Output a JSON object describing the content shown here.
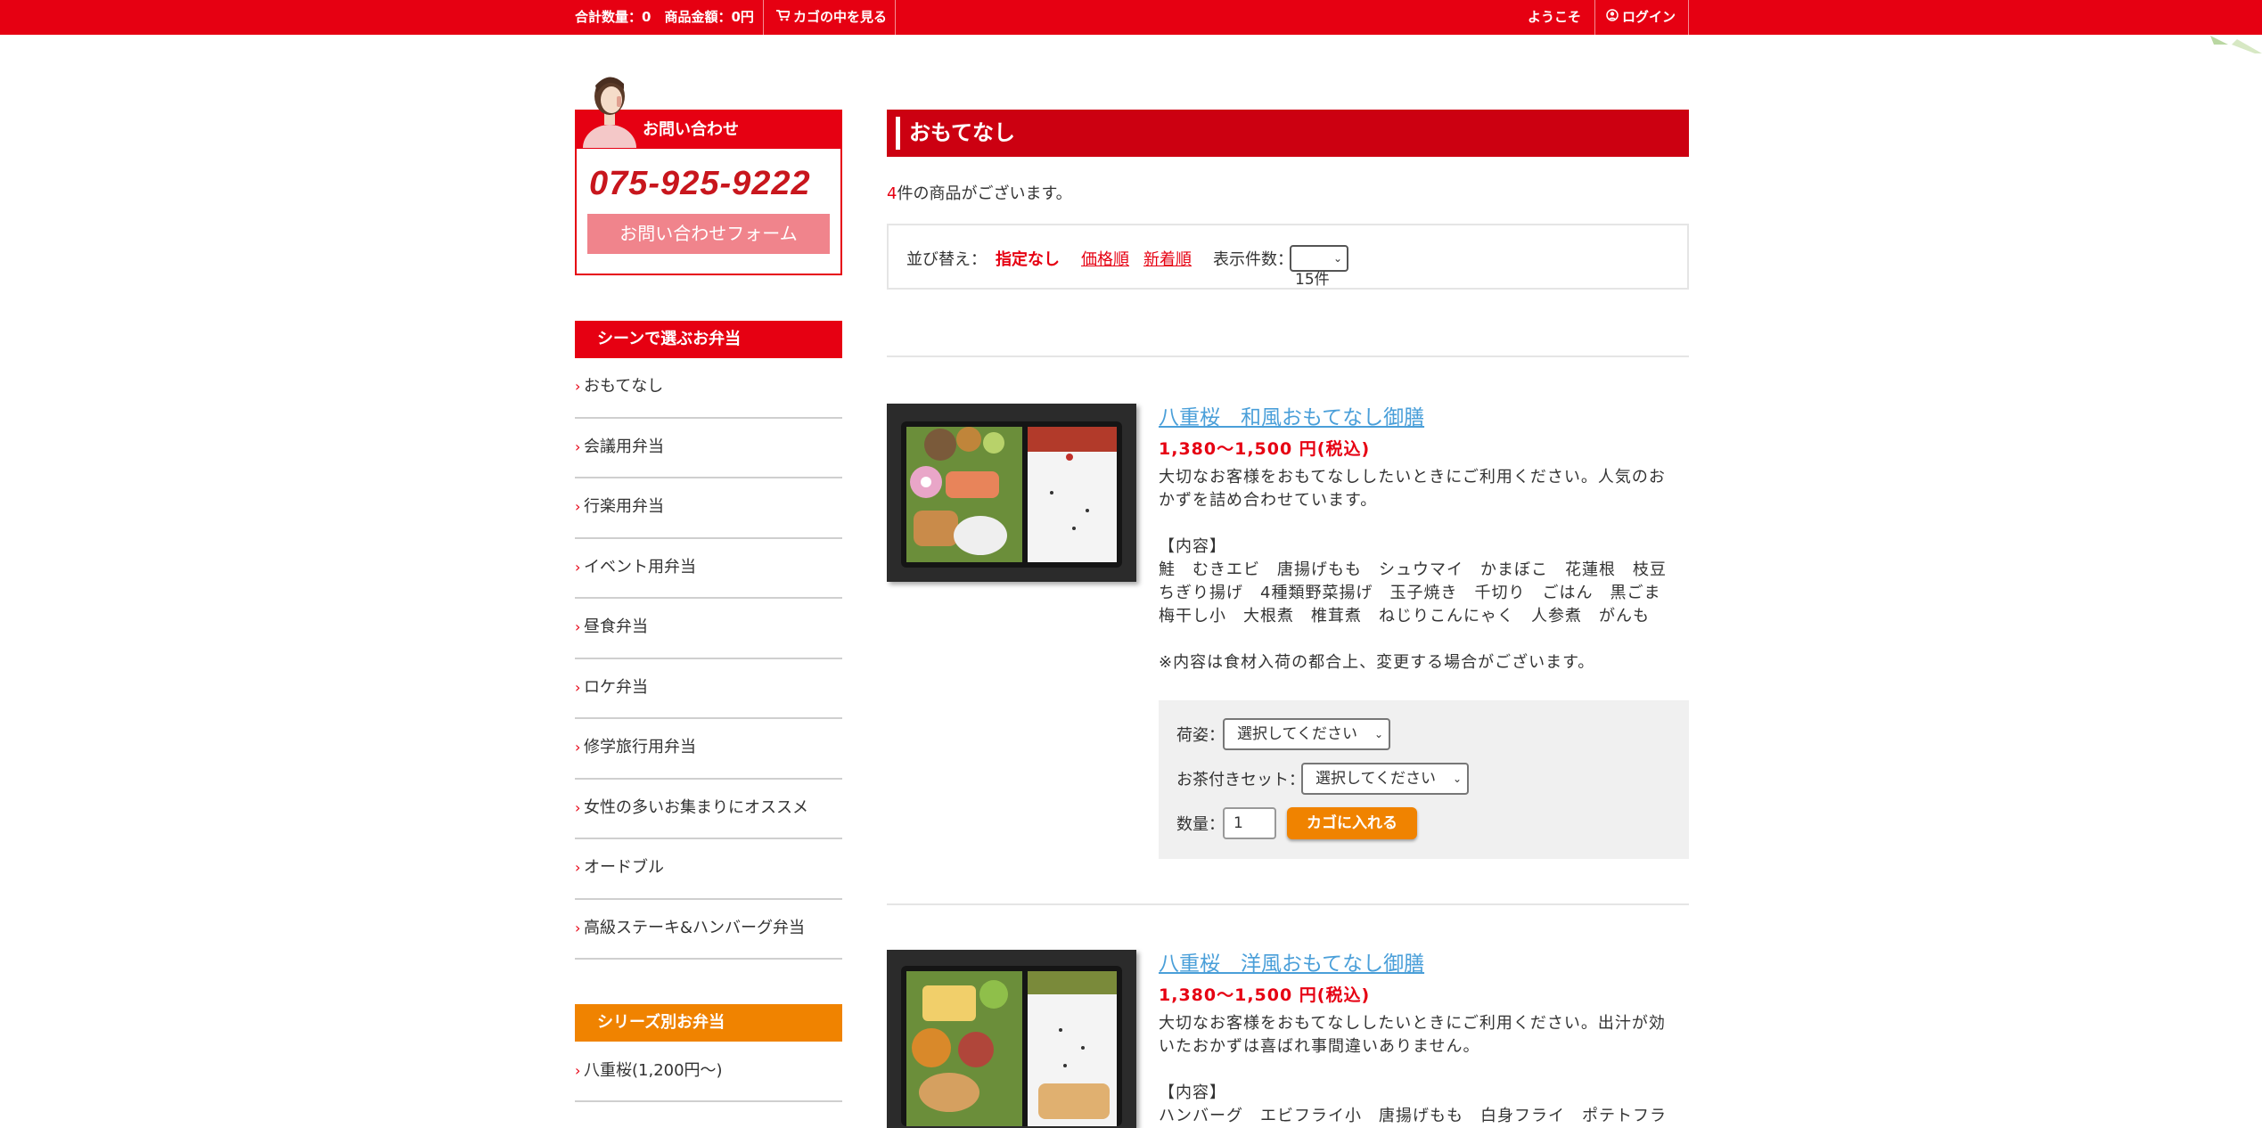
{
  "topbar": {
    "summary": "合計数量：0　商品金額：0円",
    "cart_link": "カゴの中を見る",
    "welcome": "ようこそ",
    "login": "ログイン"
  },
  "contact": {
    "title": "お問い合わせ",
    "phone": "075-925-9222",
    "form_button": "お問い合わせフォーム"
  },
  "sidebar": {
    "scene_heading": "シーンで選ぶお弁当",
    "scene_items": [
      "おもてなし",
      "会議用弁当",
      "行楽用弁当",
      "イベント用弁当",
      "昼食弁当",
      "ロケ弁当",
      "修学旅行用弁当",
      "女性の多いお集まりにオススメ",
      "オードブル",
      "高級ステーキ&ハンバーグ弁当"
    ],
    "series_heading": "シリーズ別お弁当",
    "series_items": [
      "八重桜(1,200円〜)"
    ]
  },
  "main": {
    "title": "おもてなし",
    "count_num": "4",
    "count_text": "件の商品がございます。",
    "sort": {
      "label": "並び替え：",
      "current": "指定なし",
      "price": "価格順",
      "newest": "新着順",
      "per_page_label": "表示件数：",
      "per_page_value": "15件"
    }
  },
  "products": [
    {
      "name": "八重桜　和風おもてなし御膳",
      "price": "1,380〜1,500 円(税込)",
      "desc1": "大切なお客様をおもてなししたいときにご利用ください。人気のお",
      "desc2": "かずを詰め合わせています。",
      "contents_label": "【内容】",
      "contents1": "鮭　むきエビ　唐揚げもも　シュウマイ　かまぼこ　花蓮根　枝豆",
      "contents2": "ちぎり揚げ　4種類野菜揚げ　玉子焼き　千切り　ごはん　黒ごま",
      "contents3": "梅干し小　大根煮　椎茸煮　ねじりこんにゃく　人参煮　がんも",
      "note": "※内容は食材入荷の都合上、変更する場合がございます。",
      "option1_label": "荷姿：",
      "option1_value": "選択してください",
      "option2_label": "お茶付きセット：",
      "option2_value": "選択してください",
      "qty_label": "数量：",
      "qty_value": "1",
      "add_button": "カゴに入れる"
    },
    {
      "name": "八重桜　洋風おもてなし御膳",
      "price": "1,380〜1,500 円(税込)",
      "desc1": "大切なお客様をおもてなししたいときにご利用ください。出汁が効",
      "desc2": "いたおかずは喜ばれ事間違いありません。",
      "contents_label": "【内容】",
      "contents1": "ハンバーグ　エビフライ小　唐揚げもも　白身フライ　ポテトフラ"
    }
  ],
  "colors": {
    "brand_red": "#e60012",
    "title_red": "#cc0011",
    "accent_orange": "#f08300",
    "link_blue": "#4a9fd9",
    "contact_button_pink": "#f0848c"
  },
  "icons": {
    "cart": "cart-icon",
    "user": "user-icon",
    "chevron": "chevron-right-icon",
    "select_arrow": "chevron-down-icon"
  }
}
